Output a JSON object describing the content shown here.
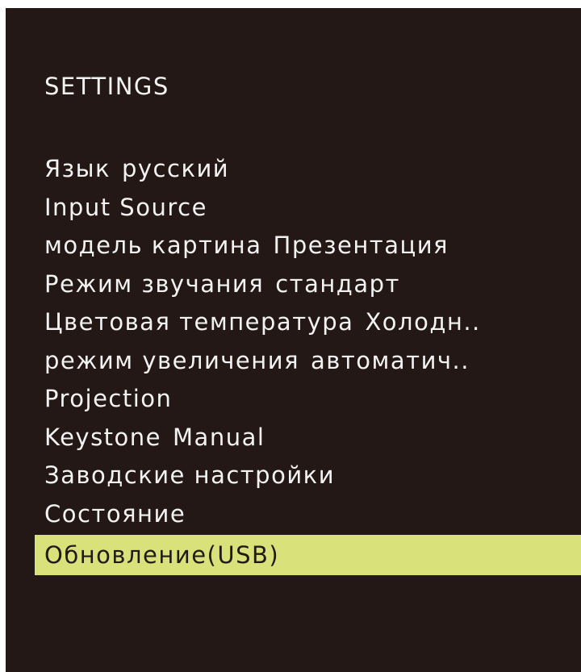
{
  "title": "SETTINGS",
  "colors": {
    "background": "#231815",
    "text": "#f2f2f2",
    "highlight": "#d9e27a"
  },
  "menu": {
    "items": [
      {
        "label": "Язык",
        "value": "русский"
      },
      {
        "label": "Input Source",
        "value": ""
      },
      {
        "label": "модель картина",
        "value": "Презентация"
      },
      {
        "label": "Режим звучания",
        "value": "стандарт"
      },
      {
        "label": "Цветовая температура",
        "value": "Холодн.."
      },
      {
        "label": "режим увеличения",
        "value": "автоматич.."
      },
      {
        "label": "Projection",
        "value": ""
      },
      {
        "label": "Keystone",
        "value": "Manual"
      },
      {
        "label": "Заводские настройки",
        "value": ""
      },
      {
        "label": "Состояние",
        "value": ""
      },
      {
        "label": "Обновление(USB)",
        "value": "",
        "selected": true
      }
    ]
  }
}
